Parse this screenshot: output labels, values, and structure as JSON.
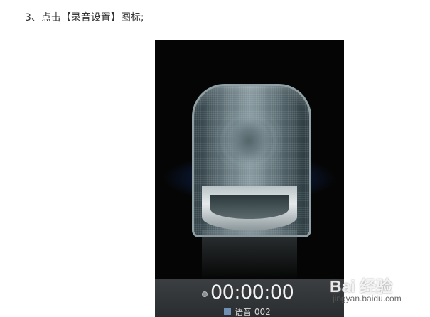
{
  "instruction": "3、点击【录音设置】图标;",
  "recorder": {
    "timer": "00:00:00",
    "file_name": "语音 002"
  },
  "watermark": {
    "brand": "Bai 经验",
    "site": "jingyan.baidu.com"
  },
  "colors": {
    "background": "#ffffff",
    "phone_background": "#050505",
    "glow": "#286ec8",
    "timer_text": "#f2f2f2"
  },
  "icons": [
    "microphone-icon",
    "record-indicator-icon",
    "audio-file-icon"
  ]
}
